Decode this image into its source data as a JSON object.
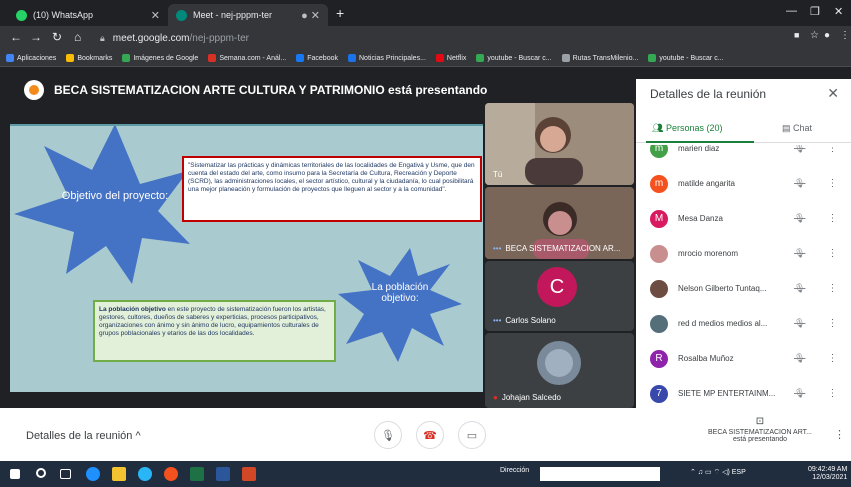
{
  "browser": {
    "tabs": [
      {
        "title": "(10) WhatsApp",
        "icon": "whatsapp-icon",
        "color": "#25d366"
      },
      {
        "title": "Meet - nej-pppm-ter",
        "icon": "meet-icon",
        "color": "#00897b"
      }
    ],
    "url_host": "meet.google.com",
    "url_path": "/nej-pppm-ter",
    "bookmarks": [
      {
        "label": "Aplicaciones",
        "color": "#4285f4"
      },
      {
        "label": "Bookmarks",
        "color": "#fbbc05"
      },
      {
        "label": "Imágenes de Google",
        "color": "#34a853"
      },
      {
        "label": "Semana.com - Anál...",
        "color": "#d93025"
      },
      {
        "label": "Facebook",
        "color": "#1877f2"
      },
      {
        "label": "Noticias Principales...",
        "color": "#1a73e8"
      },
      {
        "label": "Netflix",
        "color": "#e50914"
      },
      {
        "label": "youtube - Buscar c...",
        "color": "#34a853"
      },
      {
        "label": "Rutas TransMilenio...",
        "color": "#9aa0a6"
      },
      {
        "label": "youtube - Buscar c...",
        "color": "#34a853"
      }
    ]
  },
  "meet": {
    "presenter_text": "BECA SISTEMATIZACION ARTE CULTURA Y PATRIMONIO está presentando",
    "slide": {
      "star1": "Objetivo del proyecto:",
      "star2": "La población objetivo:",
      "box1": "\"Sistematizar las prácticas y dinámicas territoriales de las localidades de Engativá y Usme, que den cuenta del estado del arte, como insumo para la Secretaría de Cultura, Recreación y Deporte (SCRD), las administraciones locales, el sector artístico, cultural y la ciudadanía, lo cual posibilitará una mejor planeación y formulación de proyectos que lleguen al sector y a la comunidad\".",
      "box2_bold": "La población objetivo",
      "box2_rest": " en este proyecto de sistematización fueron los artistas, gestores, cultores, dueños de saberes y experticias, procesos participativos, organizaciones con ánimo y sin ánimo de lucro, equipamientos culturales de grupos poblacionales y etarios de las dos localidades."
    },
    "tiles": [
      {
        "name": "Tú"
      },
      {
        "name": "BECA SISTEMATIZACION AR..."
      },
      {
        "name": "Carlos Solano",
        "initial": "C"
      },
      {
        "name": "Johajan Salcedo"
      }
    ],
    "panel": {
      "title": "Detalles de la reunión",
      "people_tab": "Personas (20)",
      "chat_tab": "Chat",
      "people": [
        {
          "name": "marien diaz",
          "initial": "m",
          "color": "#43a047"
        },
        {
          "name": "matilde angarita",
          "initial": "m",
          "color": "#f4511e"
        },
        {
          "name": "Mesa Danza",
          "initial": "M",
          "color": "#d81b60"
        },
        {
          "name": "mrocio morenom",
          "initial": "",
          "color": "#c98f8f"
        },
        {
          "name": "Nelson Gilberto Tuntaq...",
          "initial": "",
          "color": "#6d4c41"
        },
        {
          "name": "red d medios medios al...",
          "initial": "",
          "color": "#546e7a"
        },
        {
          "name": "Rosalba Muñoz",
          "initial": "R",
          "color": "#8e24aa"
        },
        {
          "name": "SIETE MP ENTERTAINM...",
          "initial": "7",
          "color": "#3949ab"
        }
      ]
    },
    "bottom": {
      "details_label": "Detalles de la reunión",
      "presenting_name": "BECA SISTEMATIZACION ART...",
      "presenting_sub": "está presentando"
    }
  },
  "taskbar": {
    "address_label": "Dirección",
    "lang": "ESP",
    "time": "09:42:49 AM",
    "date": "12/03/2021"
  }
}
